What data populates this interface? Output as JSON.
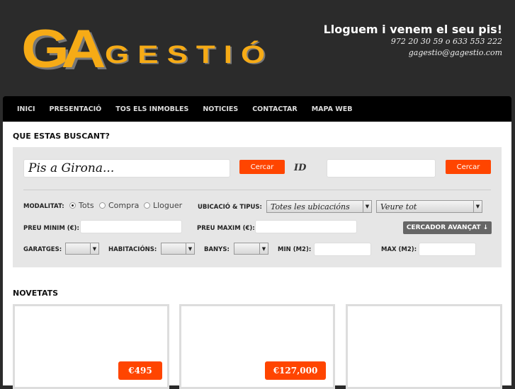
{
  "header": {
    "logo_mark": "GA",
    "logo_text": "GESTIÓ",
    "tagline": "Lloguem i venem el seu pis!",
    "phone": "972 20 30 59 o 633 553 222",
    "email": "gagestio@gagestio.com"
  },
  "nav": [
    "INICI",
    "PRESENTACIÓ",
    "TOS ELS INMOBLES",
    "NOTICIES",
    "CONTACTAR",
    "MAPA WEB"
  ],
  "search": {
    "title": "QUE ESTAS BUSCANT?",
    "query": "Pis a Girona...",
    "search_label": "Cercar",
    "id_label": "ID",
    "id_value": "",
    "id_search_label": "Cercar",
    "modalitat_label": "MODALITAT:",
    "modalitat_options": [
      "Tots",
      "Compra",
      "Lloguer"
    ],
    "modalitat_selected": "Tots",
    "ubicacio_label": "UBICACIÓ & TIPUS:",
    "ubicacio_value": "Totes les ubicacións",
    "tipus_value": "Veure tot",
    "preu_min_label": "PREU MINIM (€):",
    "preu_max_label": "PREU MAXIM (€):",
    "advanced_label": "CERCADOR AVANÇAT ↓",
    "garatges_label": "GARATGES:",
    "habitacions_label": "HABITACIÓNS:",
    "banys_label": "BANYS:",
    "min_m2_label": "MIN (M2):",
    "max_m2_label": "MAX (M2):"
  },
  "novetats": {
    "title": "NOVETATS",
    "items": [
      {
        "price": "€495"
      },
      {
        "price": "€127,000"
      },
      {
        "price": ""
      }
    ]
  }
}
